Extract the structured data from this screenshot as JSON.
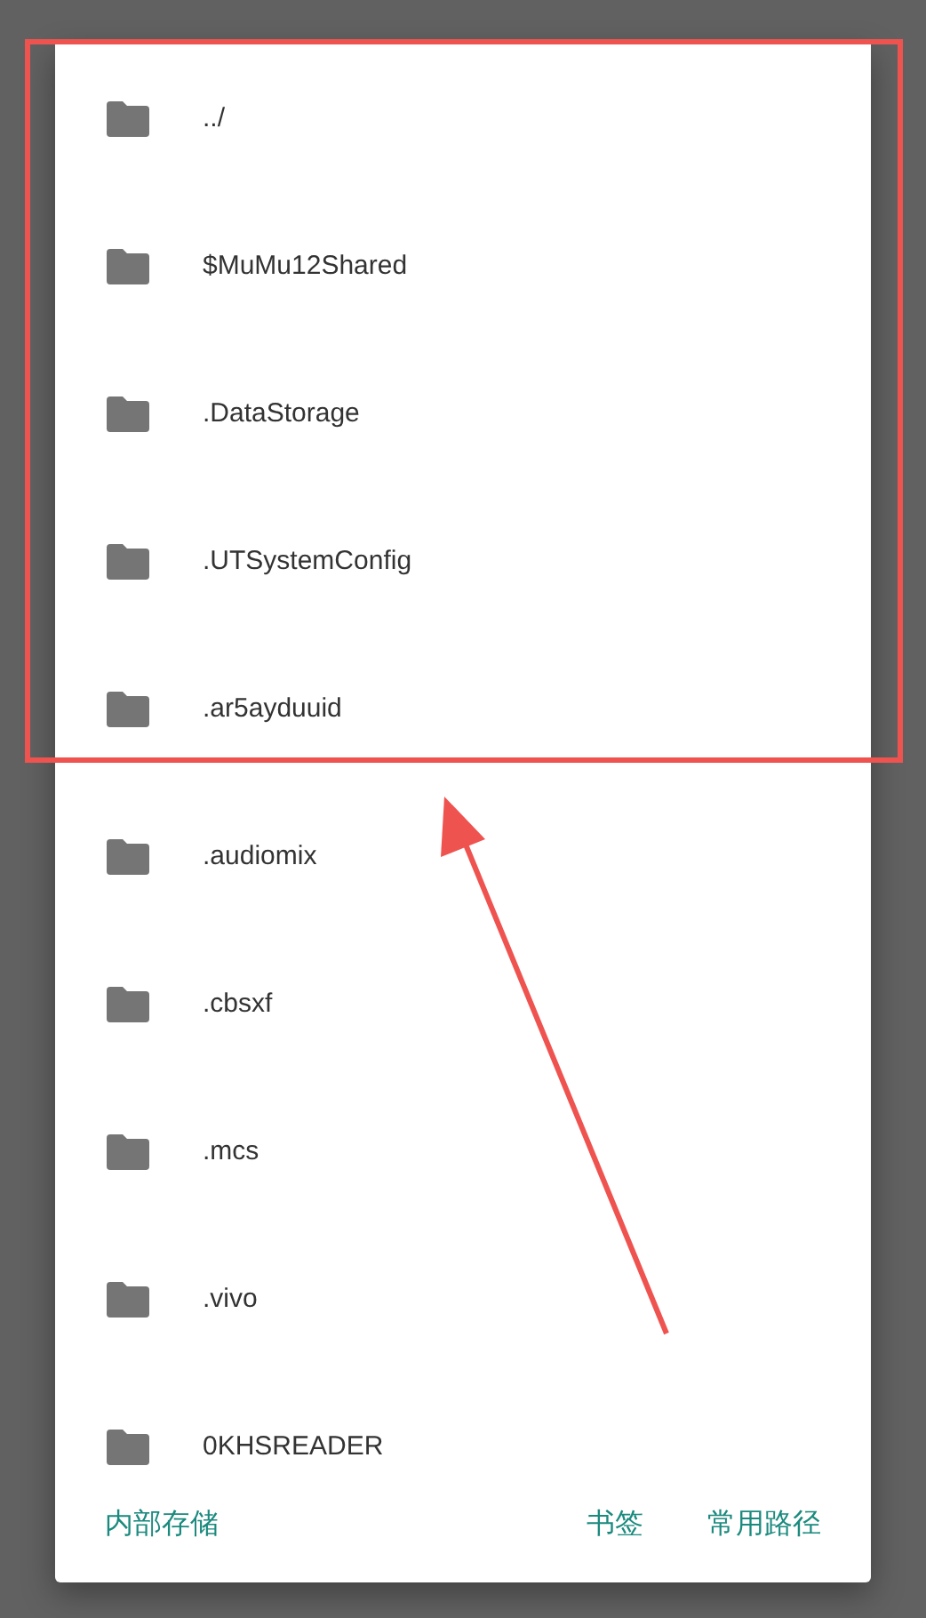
{
  "file_list": [
    {
      "name": "../"
    },
    {
      "name": "$MuMu12Shared"
    },
    {
      "name": ".DataStorage"
    },
    {
      "name": ".UTSystemConfig"
    },
    {
      "name": ".ar5ayduuid"
    },
    {
      "name": ".audiomix"
    },
    {
      "name": ".cbsxf"
    },
    {
      "name": ".mcs"
    },
    {
      "name": ".vivo"
    },
    {
      "name": "0KHSREADER"
    }
  ],
  "footer": {
    "left_button": "内部存储",
    "right_buttons": [
      "书签",
      "常用路径"
    ]
  }
}
